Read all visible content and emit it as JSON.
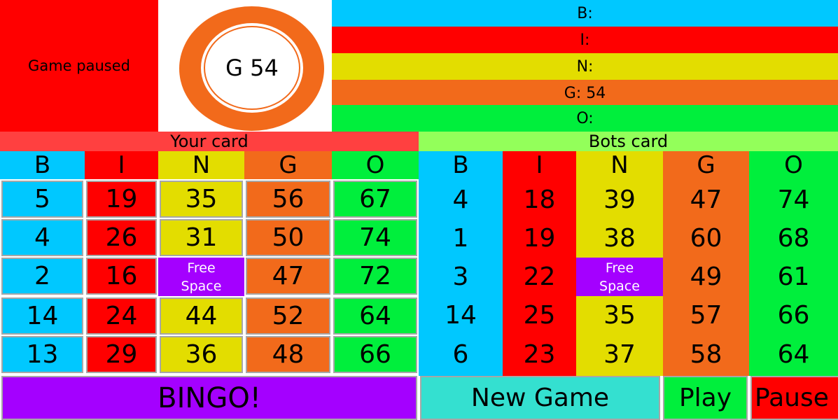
{
  "status": "Game paused",
  "current_ball": "G 54",
  "history": [
    "B:",
    "I:",
    "N:",
    "G: 54",
    "O:"
  ],
  "your_card": {
    "title": "Your card",
    "headers": [
      "B",
      "I",
      "N",
      "G",
      "O"
    ],
    "rows": [
      [
        "5",
        "19",
        "35",
        "56",
        "67"
      ],
      [
        "4",
        "26",
        "31",
        "50",
        "74"
      ],
      [
        "2",
        "16",
        "Free Space",
        "47",
        "72"
      ],
      [
        "14",
        "24",
        "44",
        "52",
        "64"
      ],
      [
        "13",
        "29",
        "36",
        "48",
        "66"
      ]
    ]
  },
  "bots_card": {
    "title": "Bots card",
    "headers": [
      "B",
      "I",
      "N",
      "G",
      "O"
    ],
    "rows": [
      [
        "4",
        "18",
        "39",
        "47",
        "74"
      ],
      [
        "1",
        "19",
        "38",
        "60",
        "68"
      ],
      [
        "3",
        "22",
        "Free Space",
        "49",
        "61"
      ],
      [
        "14",
        "25",
        "35",
        "57",
        "66"
      ],
      [
        "6",
        "23",
        "37",
        "58",
        "64"
      ]
    ]
  },
  "buttons": {
    "bingo": "BINGO!",
    "new_game": "New Game",
    "play": "Play",
    "pause": "Pause"
  },
  "colors": {
    "B": "#00c8ff",
    "I": "#ff0000",
    "N": "#e3dd00",
    "G": "#f26a1b",
    "O": "#00ef3c",
    "free": "#a400ff",
    "your_title": "#ff4040",
    "bots_title": "#93ff5a",
    "bingo_button": "#a400ff",
    "new_game_button": "#34e0d0",
    "play_button": "#00ef3c",
    "pause_button": "#ff0000"
  }
}
